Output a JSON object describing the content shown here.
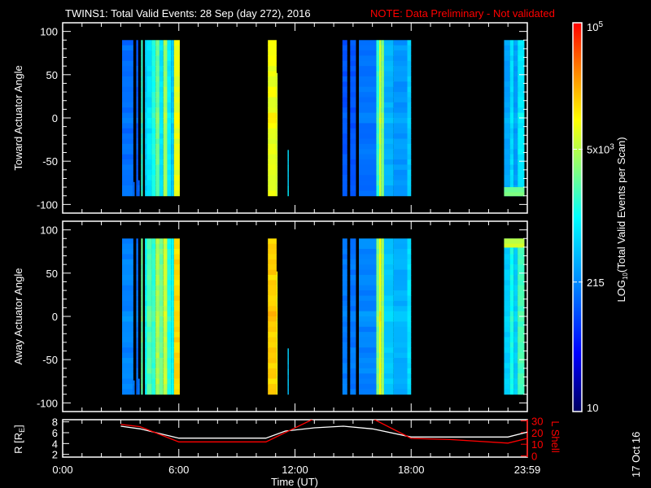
{
  "title": {
    "main": "TWINS1: Total Valid Events: 28 Sep (day 272), 2016",
    "note": "NOTE: Data Preliminary - Not validated"
  },
  "date_stamp": "17 Oct 16",
  "colors": {
    "note": "#ff0000",
    "l_shell": "#ff0000",
    "r_line": "#ffffff",
    "axes": "#ffffff",
    "background": "#000000"
  },
  "chart_data": [
    {
      "type": "heatmap",
      "panel": "toward",
      "ylabel": "Toward Actuator Angle",
      "ylim": [
        -110,
        110
      ],
      "yticks": [
        100,
        50,
        0,
        -50,
        -100
      ],
      "xlim_hours": [
        0,
        24
      ],
      "angle_range": [
        -90,
        90
      ],
      "strips": [
        {
          "t0": 3.07,
          "t1": 3.65,
          "value": 150,
          "ymin": -90
        },
        {
          "t0": 3.65,
          "t1": 3.72,
          "value": 140,
          "ymin": -90,
          "ymax": -74
        },
        {
          "t0": 3.8,
          "t1": 3.9,
          "value": 120,
          "ymin": -90
        },
        {
          "t0": 3.9,
          "t1": 3.98,
          "value": 140,
          "ymin": -90,
          "ymax": -72
        },
        {
          "t0": 4.05,
          "t1": 4.14,
          "value": 1500
        },
        {
          "t0": 4.25,
          "t1": 4.35,
          "value": 500
        },
        {
          "t0": 4.35,
          "t1": 4.6,
          "value": 700
        },
        {
          "t0": 4.6,
          "t1": 4.8,
          "value": 1200
        },
        {
          "t0": 4.8,
          "t1": 5.0,
          "value": 2500
        },
        {
          "t0": 5.0,
          "t1": 5.2,
          "value": 700
        },
        {
          "t0": 5.2,
          "t1": 5.4,
          "value": 4000
        },
        {
          "t0": 5.4,
          "t1": 5.6,
          "value": 800
        },
        {
          "t0": 5.6,
          "t1": 5.75,
          "value": 500
        },
        {
          "t0": 5.75,
          "t1": 6.05,
          "value": 8000
        },
        {
          "t0": 10.6,
          "t1": 11.05,
          "value": 8500
        },
        {
          "t0": 11.05,
          "t1": 11.1,
          "value": 6000,
          "ymax": 52
        },
        {
          "t0": 11.62,
          "t1": 11.68,
          "value": 700,
          "ymax": -37
        },
        {
          "t0": 14.45,
          "t1": 14.7,
          "value": 110
        },
        {
          "t0": 14.85,
          "t1": 15.15,
          "value": 110
        },
        {
          "t0": 15.3,
          "t1": 16.2,
          "value": 160
        },
        {
          "t0": 16.2,
          "t1": 16.35,
          "value": 1500
        },
        {
          "t0": 16.35,
          "t1": 16.45,
          "value": 6000
        },
        {
          "t0": 16.45,
          "t1": 16.6,
          "value": 3000
        },
        {
          "t0": 16.6,
          "t1": 17.1,
          "value": 350
        },
        {
          "t0": 17.1,
          "t1": 17.8,
          "value": 250
        },
        {
          "t0": 17.8,
          "t1": 18.0,
          "value": 500
        },
        {
          "t0": 22.8,
          "t1": 23.1,
          "value": 300
        },
        {
          "t0": 23.1,
          "t1": 23.3,
          "value": 600
        },
        {
          "t0": 23.3,
          "t1": 23.5,
          "value": 280
        },
        {
          "t0": 23.5,
          "t1": 23.85,
          "value": 800
        },
        {
          "t0": 22.8,
          "t1": 23.85,
          "value": 2500,
          "ymax": -80
        }
      ]
    },
    {
      "type": "heatmap",
      "panel": "away",
      "ylabel": "Away Actuator Angle",
      "ylim": [
        -110,
        110
      ],
      "yticks": [
        100,
        50,
        0,
        -50,
        -100
      ],
      "xlim_hours": [
        0,
        24
      ],
      "angle_range": [
        -90,
        90
      ],
      "strips": [
        {
          "t0": 3.07,
          "t1": 3.65,
          "value": 200,
          "ymin": -90
        },
        {
          "t0": 3.65,
          "t1": 3.72,
          "value": 180,
          "ymin": -90,
          "ymax": -74
        },
        {
          "t0": 3.8,
          "t1": 3.9,
          "value": 160,
          "ymin": -90
        },
        {
          "t0": 3.9,
          "t1": 3.98,
          "value": 160,
          "ymin": -90,
          "ymax": -72
        },
        {
          "t0": 4.05,
          "t1": 4.14,
          "value": 2500
        },
        {
          "t0": 4.25,
          "t1": 4.35,
          "value": 900
        },
        {
          "t0": 4.35,
          "t1": 4.6,
          "value": 2000
        },
        {
          "t0": 4.6,
          "t1": 4.8,
          "value": 1500
        },
        {
          "t0": 4.8,
          "t1": 5.0,
          "value": 4500
        },
        {
          "t0": 5.0,
          "t1": 5.2,
          "value": 2500
        },
        {
          "t0": 5.2,
          "t1": 5.4,
          "value": 6000
        },
        {
          "t0": 5.4,
          "t1": 5.6,
          "value": 1200
        },
        {
          "t0": 5.6,
          "t1": 5.75,
          "value": 1000
        },
        {
          "t0": 5.75,
          "t1": 6.05,
          "value": 14000
        },
        {
          "t0": 10.6,
          "t1": 11.05,
          "value": 15000
        },
        {
          "t0": 11.05,
          "t1": 11.1,
          "value": 9000,
          "ymax": 52
        },
        {
          "t0": 11.62,
          "t1": 11.68,
          "value": 500,
          "ymax": -37
        },
        {
          "t0": 14.45,
          "t1": 14.7,
          "value": 170
        },
        {
          "t0": 14.85,
          "t1": 15.15,
          "value": 170
        },
        {
          "t0": 15.3,
          "t1": 16.2,
          "value": 200
        },
        {
          "t0": 16.2,
          "t1": 16.35,
          "value": 3000
        },
        {
          "t0": 16.35,
          "t1": 16.45,
          "value": 9000
        },
        {
          "t0": 16.45,
          "t1": 16.6,
          "value": 4000
        },
        {
          "t0": 16.6,
          "t1": 17.1,
          "value": 500
        },
        {
          "t0": 17.1,
          "t1": 17.8,
          "value": 350
        },
        {
          "t0": 17.8,
          "t1": 18.0,
          "value": 700
        },
        {
          "t0": 22.8,
          "t1": 23.1,
          "value": 500
        },
        {
          "t0": 23.1,
          "t1": 23.3,
          "value": 1200
        },
        {
          "t0": 23.3,
          "t1": 23.5,
          "value": 500
        },
        {
          "t0": 23.5,
          "t1": 23.85,
          "value": 1800
        },
        {
          "t0": 22.8,
          "t1": 23.85,
          "value": 6000,
          "ymin": 80
        }
      ]
    },
    {
      "type": "line",
      "panel": "orbit",
      "xlabel": "Time (UT)",
      "xticklabels": [
        "0:00",
        "6:00",
        "12:00",
        "18:00",
        "23:59"
      ],
      "xticks_hours": [
        0,
        6,
        12,
        18,
        24
      ],
      "ylabel": "R [R_E]",
      "ylabel_main": "R [R",
      "ylabel_sub": "E",
      "ylabel_close": "]",
      "ylim": [
        1.5,
        8.4
      ],
      "yticks": [
        2,
        4,
        6,
        8
      ],
      "y2label": "L Shell",
      "y2lim": [
        -1,
        31
      ],
      "y2ticks": [
        0,
        10,
        20,
        30
      ],
      "series": [
        {
          "name": "R",
          "color": "#ffffff",
          "x": [
            3,
            4,
            6,
            10.5,
            11.5,
            13,
            14.5,
            16,
            18,
            23,
            24
          ],
          "y": [
            7.2,
            6.7,
            5.0,
            5.0,
            6.3,
            6.9,
            7.2,
            6.7,
            5.2,
            5.2,
            6.1
          ]
        },
        {
          "name": "L Shell",
          "color": "#ff0000",
          "x": [
            3,
            4,
            6,
            10.5,
            13,
            16,
            18,
            20,
            23,
            24
          ],
          "y": [
            27,
            25,
            12,
            12,
            32,
            32,
            15,
            14,
            11,
            15
          ]
        }
      ]
    }
  ],
  "colorbar": {
    "label_prefix": "LOG",
    "label_sub": "10",
    "label_rest": "(Total Valid Events per Scan)",
    "range": [
      10,
      100000
    ],
    "ticks": [
      {
        "value": 10,
        "label": "10"
      },
      {
        "value": 215,
        "label": "215"
      },
      {
        "value": 5000,
        "label": "5x10",
        "sup": "3"
      },
      {
        "value": 100000,
        "label": "10",
        "sup": "5"
      }
    ]
  }
}
